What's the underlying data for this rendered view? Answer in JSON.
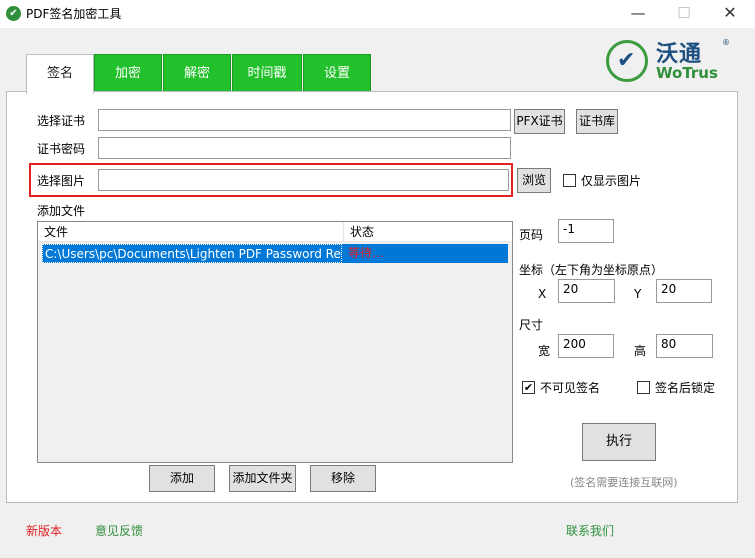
{
  "window": {
    "title": "PDF签名加密工具",
    "minimize": "—",
    "maximize": "☐",
    "close": "✕"
  },
  "logo": {
    "cn": "沃通",
    "en": "WoTrus",
    "reg": "®",
    "mark": "✔"
  },
  "tabs": [
    {
      "label": "签名",
      "active": true
    },
    {
      "label": "加密"
    },
    {
      "label": "解密"
    },
    {
      "label": "时间戳"
    },
    {
      "label": "设置"
    }
  ],
  "form": {
    "cert_label": "选择证书",
    "cert_value": "",
    "pfx_button": "PFX证书",
    "certstore_button": "证书库",
    "password_label": "证书密码",
    "password_value": "",
    "image_label": "选择图片",
    "image_value": "",
    "browse_button": "浏览",
    "only_image_label": "仅显示图片",
    "add_file_label": "添加文件"
  },
  "file_list": {
    "columns": [
      "文件",
      "状态"
    ],
    "rows": [
      {
        "file": "C:\\Users\\pc\\Documents\\Lighten PDF Password Rem",
        "status": "等待..."
      }
    ]
  },
  "file_buttons": {
    "add": "添加",
    "add_folder": "添加文件夹",
    "remove": "移除"
  },
  "settings": {
    "page_label": "页码",
    "page_value": "-1",
    "coord_label": "坐标（左下角为坐标原点）",
    "x_label": "X",
    "x_value": "20",
    "y_label": "Y",
    "y_value": "20",
    "size_label": "尺寸",
    "width_label": "宽",
    "width_value": "200",
    "height_label": "高",
    "height_value": "80",
    "invisible_label": "不可见签名",
    "invisible_checked": true,
    "lock_label": "签名后锁定",
    "lock_checked": false,
    "execute_button": "执行",
    "network_note": "(签名需要连接互联网)"
  },
  "footer": {
    "new_version": "新版本",
    "feedback": "意见反馈",
    "contact": "联系我们"
  },
  "colors": {
    "tab_green": "#22c02a",
    "selection_blue": "#0078d7",
    "alert_red": "#e02020",
    "link_green": "#2f8f3a"
  }
}
